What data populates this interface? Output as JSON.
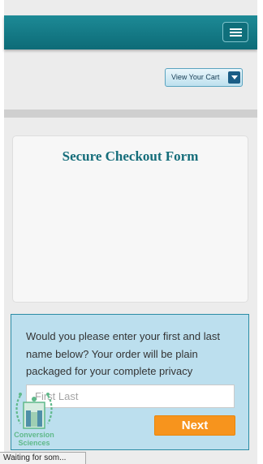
{
  "header": {
    "menu_icon": "hamburger-menu-icon",
    "colors": {
      "bar": "#0d6b77"
    }
  },
  "cart": {
    "label": "View Your Cart",
    "icon": "chevron-down-icon"
  },
  "form_card": {
    "title": "Secure Checkout Form"
  },
  "info": {
    "text": "Would you please enter your first and last name below? Your order will be plain packaged for your complete privacy",
    "name_placeholder": "First Last",
    "next_label": "Next",
    "colors": {
      "next": "#f7941d",
      "panel": "#bcdfee"
    }
  },
  "logo": {
    "line1": "Conversion",
    "line2": "Sciences"
  },
  "status_bar": {
    "text": "Waiting for som..."
  }
}
